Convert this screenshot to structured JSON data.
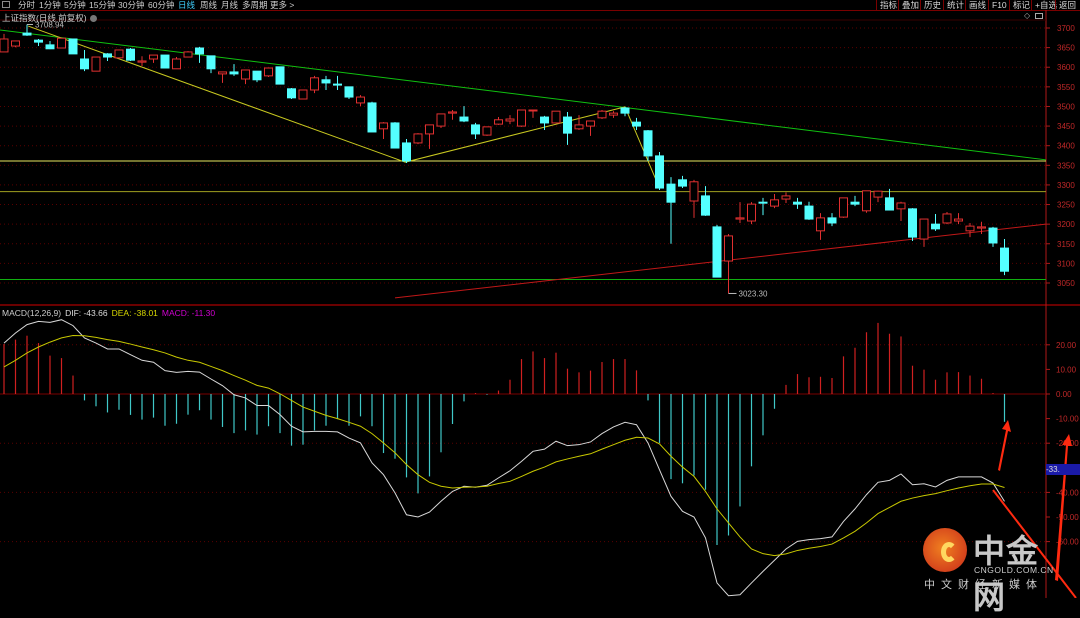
{
  "toolbar": {
    "periods": [
      "分时",
      "1分钟",
      "5分钟",
      "15分钟",
      "30分钟",
      "60分钟",
      "日线",
      "周线",
      "月线",
      "多周期",
      "更多 >"
    ],
    "active_period": "日线",
    "right_buttons": [
      "指标",
      "叠加",
      "历史",
      "统计",
      "画线",
      "F10",
      "标记",
      "+自选",
      "返回"
    ]
  },
  "title": "上证指数(日线 前复权)",
  "macd_legend": {
    "name": "MACD(12,26,9)",
    "dif": "DIF: -43.66",
    "dea": "DEA: -38.01",
    "macd": "MACD: -11.30"
  },
  "colors": {
    "up": "#e03030",
    "down": "#54ffff",
    "dif": "#d8d8d8",
    "dea": "#c8c800",
    "macd_label": "#d000d0",
    "grid": "#5a0000",
    "axis": "#b01818"
  },
  "cursor_label": "-33.",
  "watermark": {
    "brand": "中金网",
    "url": "CNGOLD.COM.CN",
    "sub": "中文财经新媒体"
  },
  "chart_data": [
    {
      "type": "candlestick",
      "title": "上证指数(日线 前复权)",
      "yticks": [
        3700,
        3650,
        3600,
        3550,
        3500,
        3450,
        3400,
        3350,
        3300,
        3250,
        3200,
        3150,
        3100,
        3050
      ],
      "ylim": [
        3030,
        3720
      ],
      "high_label": "3708.94",
      "low_label": "3023.30",
      "candles_ohlc": [
        [
          3639,
          3685,
          3639,
          3672
        ],
        [
          3654,
          3667,
          3651,
          3667
        ],
        [
          3687,
          3709,
          3680,
          3682
        ],
        [
          3669,
          3672,
          3654,
          3664
        ],
        [
          3657,
          3667,
          3646,
          3647
        ],
        [
          3649,
          3674,
          3649,
          3674
        ],
        [
          3672,
          3672,
          3634,
          3634
        ],
        [
          3621,
          3644,
          3590,
          3596
        ],
        [
          3590,
          3626,
          3590,
          3626
        ],
        [
          3634,
          3636,
          3616,
          3626
        ],
        [
          3624,
          3644,
          3622,
          3644
        ],
        [
          3646,
          3649,
          3616,
          3618
        ],
        [
          3613,
          3628,
          3603,
          3616
        ],
        [
          3621,
          3631,
          3611,
          3631
        ],
        [
          3631,
          3631,
          3598,
          3598
        ],
        [
          3596,
          3626,
          3596,
          3621
        ],
        [
          3626,
          3641,
          3626,
          3639
        ],
        [
          3649,
          3652,
          3611,
          3634
        ],
        [
          3629,
          3629,
          3585,
          3596
        ],
        [
          3583,
          3588,
          3560,
          3588
        ],
        [
          3588,
          3608,
          3578,
          3583
        ],
        [
          3570,
          3593,
          3557,
          3593
        ],
        [
          3590,
          3590,
          3562,
          3568
        ],
        [
          3578,
          3598,
          3575,
          3598
        ],
        [
          3601,
          3601,
          3557,
          3557
        ],
        [
          3545,
          3547,
          3519,
          3522
        ],
        [
          3519,
          3542,
          3519,
          3542
        ],
        [
          3542,
          3578,
          3534,
          3573
        ],
        [
          3568,
          3578,
          3542,
          3560
        ],
        [
          3557,
          3578,
          3542,
          3555
        ],
        [
          3550,
          3550,
          3519,
          3524
        ],
        [
          3509,
          3529,
          3501,
          3524
        ],
        [
          3509,
          3512,
          3435,
          3435
        ],
        [
          3443,
          3460,
          3417,
          3458
        ],
        [
          3458,
          3460,
          3394,
          3394
        ],
        [
          3407,
          3417,
          3356,
          3361
        ],
        [
          3407,
          3432,
          3404,
          3430
        ],
        [
          3430,
          3453,
          3392,
          3453
        ],
        [
          3450,
          3481,
          3445,
          3481
        ],
        [
          3483,
          3491,
          3466,
          3486
        ],
        [
          3473,
          3501,
          3460,
          3463
        ],
        [
          3453,
          3458,
          3417,
          3430
        ],
        [
          3427,
          3448,
          3425,
          3448
        ],
        [
          3455,
          3473,
          3453,
          3466
        ],
        [
          3463,
          3478,
          3455,
          3468
        ],
        [
          3450,
          3491,
          3448,
          3491
        ],
        [
          3489,
          3491,
          3471,
          3491
        ],
        [
          3473,
          3476,
          3440,
          3458
        ],
        [
          3458,
          3488,
          3458,
          3488
        ],
        [
          3473,
          3486,
          3402,
          3432
        ],
        [
          3443,
          3478,
          3440,
          3453
        ],
        [
          3450,
          3463,
          3425,
          3463
        ],
        [
          3471,
          3491,
          3468,
          3488
        ],
        [
          3478,
          3488,
          3471,
          3483
        ],
        [
          3496,
          3499,
          3475,
          3483
        ],
        [
          3460,
          3471,
          3440,
          3450
        ],
        [
          3438,
          3440,
          3361,
          3374
        ],
        [
          3374,
          3384,
          3287,
          3292
        ],
        [
          3302,
          3320,
          3150,
          3256
        ],
        [
          3313,
          3323,
          3292,
          3297
        ],
        [
          3259,
          3313,
          3216,
          3308
        ],
        [
          3272,
          3297,
          3221,
          3223
        ],
        [
          3193,
          3198,
          3065,
          3065
        ],
        [
          3106,
          3175,
          3023.3,
          3170
        ],
        [
          3213,
          3256,
          3203,
          3216
        ],
        [
          3208,
          3256,
          3200,
          3251
        ],
        [
          3256,
          3267,
          3223,
          3254
        ],
        [
          3246,
          3277,
          3241,
          3262
        ],
        [
          3264,
          3281,
          3254,
          3272
        ],
        [
          3256,
          3267,
          3239,
          3251
        ],
        [
          3246,
          3257,
          3211,
          3213
        ],
        [
          3183,
          3228,
          3160,
          3216
        ],
        [
          3216,
          3228,
          3195,
          3203
        ],
        [
          3218,
          3267,
          3216,
          3267
        ],
        [
          3256,
          3272,
          3246,
          3251
        ],
        [
          3234,
          3285,
          3229,
          3285
        ],
        [
          3269,
          3285,
          3256,
          3284
        ],
        [
          3267,
          3290,
          3236,
          3236
        ],
        [
          3239,
          3257,
          3208,
          3254
        ],
        [
          3239,
          3241,
          3157,
          3167
        ],
        [
          3162,
          3213,
          3142,
          3213
        ],
        [
          3200,
          3226,
          3183,
          3188
        ],
        [
          3203,
          3231,
          3200,
          3226
        ],
        [
          3208,
          3228,
          3200,
          3213
        ],
        [
          3183,
          3203,
          3167,
          3195
        ],
        [
          3190,
          3206,
          3175,
          3193
        ],
        [
          3190,
          3193,
          3142,
          3152
        ],
        [
          3139,
          3162,
          3070,
          3080
        ]
      ],
      "annotations": {
        "horizontal_lines": [
          {
            "price": 3361,
            "color": "#e8e860"
          },
          {
            "price": 3283,
            "color": "#a0a020"
          },
          {
            "price": 3059,
            "color": "#10b010"
          }
        ],
        "trend_lines": [
          {
            "points": [
              [
                -0.35,
                3695
              ],
              [
                90.6,
                3364
              ]
            ],
            "color": "#10c010"
          },
          {
            "points": [
              [
                34,
                3012
              ],
              [
                90.6,
                3200
              ]
            ],
            "color": "#c01818"
          },
          {
            "points": [
              [
                2.1,
                3705
              ],
              [
                34.9,
                3358
              ],
              [
                54,
                3499
              ],
              [
                57,
                3292
              ]
            ],
            "color": "#c8c820"
          }
        ]
      }
    },
    {
      "type": "macd",
      "params": "MACD(12,26,9)",
      "yticks": [
        20,
        10,
        0,
        -10,
        -20,
        -40,
        -50,
        -60
      ],
      "ylim": [
        -83,
        36
      ],
      "dif": [
        20.7,
        24.8,
        28.2,
        29.5,
        29.1,
        30.2,
        27.8,
        22.8,
        20.7,
        18.3,
        18.3,
        16.0,
        13.7,
        12.9,
        9.5,
        8.8,
        9.2,
        8.9,
        6.1,
        3.4,
        -0.3,
        -1.6,
        -4.7,
        -4.7,
        -8.4,
        -13.1,
        -15.4,
        -15.2,
        -15.2,
        -15.4,
        -17.9,
        -19.9,
        -28.0,
        -32.8,
        -40.2,
        -49.1,
        -50.0,
        -48.0,
        -43.6,
        -39.6,
        -37.5,
        -37.9,
        -37.1,
        -34.1,
        -31.2,
        -27.4,
        -23.3,
        -22.4,
        -19.2,
        -21.0,
        -20.6,
        -19.5,
        -16.1,
        -13.4,
        -11.5,
        -12.5,
        -19.9,
        -30.8,
        -41.6,
        -47.7,
        -50.0,
        -58.5,
        -76.8,
        -82.0,
        -81.6,
        -76.8,
        -72.1,
        -67.6,
        -63.0,
        -59.9,
        -59.2,
        -58.8,
        -58.1,
        -51.8,
        -46.7,
        -40.9,
        -35.9,
        -35.1,
        -32.5,
        -36.9,
        -36.5,
        -37.8,
        -35.1,
        -33.7,
        -33.7,
        -33.7,
        -36.2,
        -43.66
      ],
      "dea": [
        11.0,
        13.7,
        16.7,
        19.1,
        21.1,
        22.8,
        23.8,
        23.7,
        23.0,
        22.1,
        21.4,
        20.3,
        19.1,
        18.0,
        16.7,
        15.0,
        13.7,
        12.9,
        11.2,
        9.5,
        7.5,
        5.6,
        3.5,
        2.4,
        0.1,
        -2.6,
        -5.3,
        -7.0,
        -8.7,
        -10.0,
        -11.5,
        -13.1,
        -16.1,
        -19.9,
        -23.9,
        -28.7,
        -32.8,
        -35.9,
        -37.5,
        -38.2,
        -37.9,
        -37.8,
        -37.5,
        -36.4,
        -35.5,
        -33.5,
        -31.4,
        -29.7,
        -27.6,
        -26.4,
        -25.3,
        -24.3,
        -22.4,
        -20.6,
        -18.8,
        -17.6,
        -17.9,
        -20.3,
        -25.3,
        -29.7,
        -33.5,
        -39.6,
        -46.7,
        -52.4,
        -58.1,
        -63.0,
        -64.9,
        -65.7,
        -65.0,
        -63.6,
        -62.7,
        -62.0,
        -61.0,
        -58.5,
        -55.8,
        -52.4,
        -48.6,
        -46.1,
        -43.6,
        -42.3,
        -41.3,
        -40.5,
        -39.3,
        -38.2,
        -37.3,
        -36.6,
        -36.6,
        -38.01
      ],
      "macd": [
        20.3,
        22.1,
        23.7,
        20.7,
        15.6,
        14.6,
        7.5,
        -2.6,
        -5.0,
        -7.5,
        -6.4,
        -8.5,
        -10.4,
        -9.6,
        -12.9,
        -12.1,
        -8.4,
        -6.6,
        -10.4,
        -13.4,
        -15.9,
        -14.8,
        -16.5,
        -13.1,
        -15.9,
        -21.0,
        -20.6,
        -14.8,
        -12.9,
        -10.2,
        -12.9,
        -9.1,
        -13.1,
        -24.0,
        -26.3,
        -33.9,
        -40.4,
        -33.5,
        -23.7,
        -12.2,
        -3.0,
        0.4,
        -0.3,
        1.4,
        5.8,
        14.2,
        17.3,
        14.6,
        16.8,
        10.3,
        8.8,
        9.5,
        13.0,
        14.2,
        14.2,
        9.6,
        -2.6,
        -19.9,
        -34.6,
        -36.3,
        -33.1,
        -38.9,
        -61.4,
        -57.5,
        -45.7,
        -29.4,
        -16.8,
        -6.0,
        3.7,
        8.1,
        6.8,
        7.0,
        6.5,
        15.3,
        18.8,
        25.1,
        28.9,
        24.5,
        23.4,
        11.5,
        9.9,
        5.8,
        8.8,
        8.9,
        7.5,
        6.2,
        0.4,
        -11.3
      ]
    }
  ]
}
